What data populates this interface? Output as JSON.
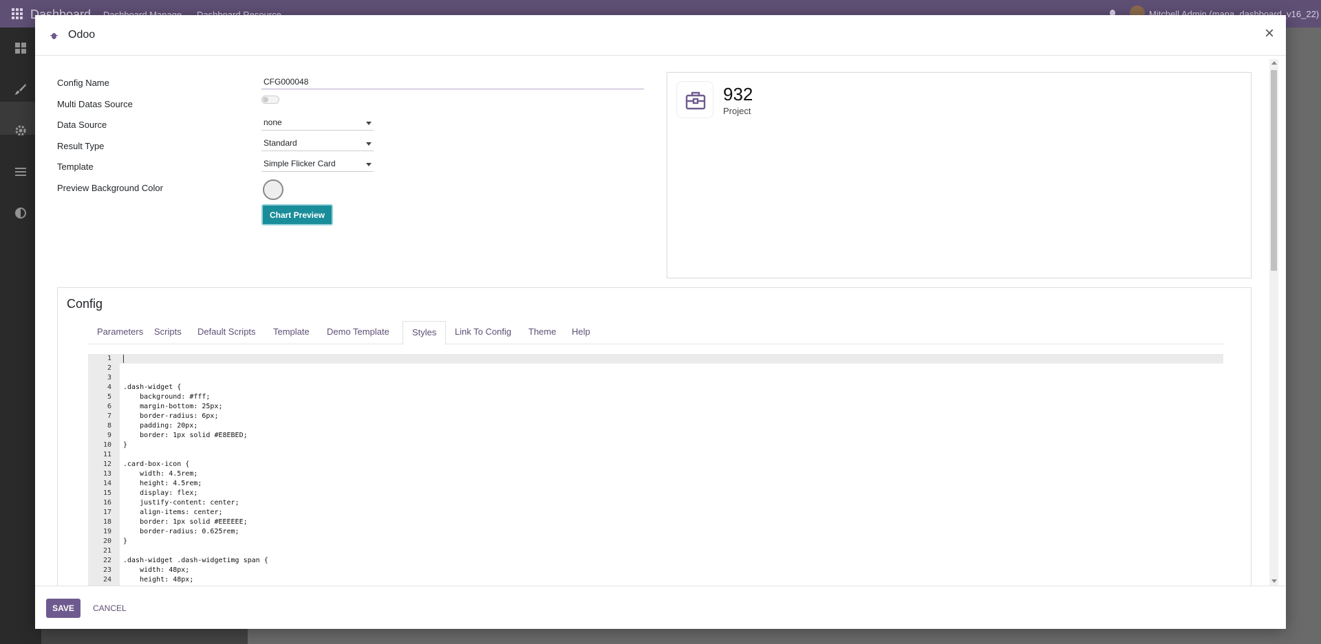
{
  "topbar": {
    "brand": "Dashboard",
    "menu": [
      "Dashboard Manage",
      "Dashboard Resource"
    ],
    "user": "Mitchell Admin (mana_dashboard_v16_22)"
  },
  "sidebar_icons": [
    "dashboard-icon",
    "brush-icon",
    "gear-icon",
    "list-icon",
    "contrast-icon"
  ],
  "modal": {
    "title": "Odoo",
    "close_label": "×"
  },
  "form": {
    "config_name_label": "Config Name",
    "config_name_value": "CFG000048",
    "multi_source_label": "Multi Datas Source",
    "data_source_label": "Data Source",
    "data_source_value": "none",
    "result_type_label": "Result Type",
    "result_type_value": "Standard",
    "template_label": "Template",
    "template_value": "Simple Flicker Card",
    "bg_color_label": "Preview Background Color",
    "chart_preview_label": "Chart Preview"
  },
  "preview_card": {
    "value": "932",
    "label": "Project",
    "icon": "briefcase-icon",
    "icon_color": "#6e5a8f"
  },
  "config": {
    "title": "Config",
    "tabs": [
      "Parameters",
      "Scripts",
      "Default Scripts",
      "Template",
      "Demo Template",
      "Styles",
      "Link To Config",
      "Theme",
      "Help"
    ],
    "active_tab": "Styles"
  },
  "code_lines": [
    "",
    "",
    "",
    ".dash-widget {",
    "    background: #fff;",
    "    margin-bottom: 25px;",
    "    border-radius: 6px;",
    "    padding: 20px;",
    "    border: 1px solid #E8EBED;",
    "}",
    "",
    ".card-box-icon {",
    "    width: 4.5rem;",
    "    height: 4.5rem;",
    "    display: flex;",
    "    justify-content: center;",
    "    align-items: center;",
    "    border: 1px solid #EEEEEE;",
    "    border-radius: 0.625rem;",
    "}",
    "",
    ".dash-widget .dash-widgetimg span {",
    "    width: 48px;",
    "    height: 48px;"
  ],
  "footer": {
    "save_label": "SAVE",
    "cancel_label": "CANCEL"
  },
  "colors": {
    "brand_purple": "#5f4f75",
    "save_button": "#6e5a8f",
    "preview_button": "#1a8d9a"
  }
}
